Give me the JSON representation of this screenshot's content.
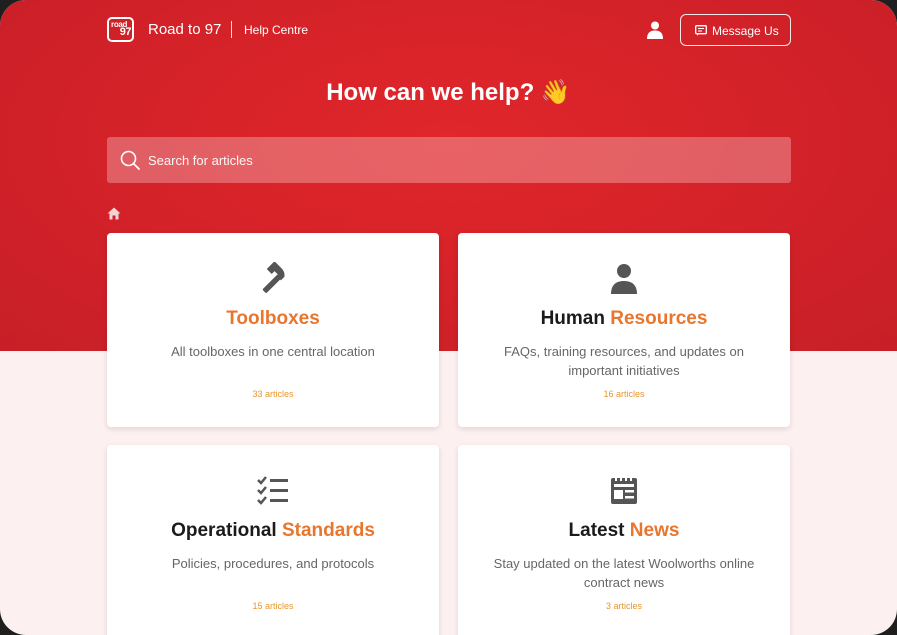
{
  "header": {
    "logo_line1": "road",
    "logo_line2": "97",
    "brand_name": "Road to 97",
    "brand_sub": "Help Centre",
    "message_button": "Message Us"
  },
  "hero": {
    "headline": "How can we help? 👋"
  },
  "search": {
    "placeholder": "Search for articles"
  },
  "cards": [
    {
      "title_main": "",
      "title_accent": "Toolboxes",
      "description": "All toolboxes in one central location",
      "count": "33 articles",
      "icon": "hammer-icon"
    },
    {
      "title_main": "Human ",
      "title_accent": "Resources",
      "description": "FAQs, training resources, and updates on important initiatives",
      "count": "16 articles",
      "icon": "person-icon"
    },
    {
      "title_main": "Operational ",
      "title_accent": "Standards",
      "description": "Policies, procedures, and protocols",
      "count": "15 articles",
      "icon": "checklist-icon"
    },
    {
      "title_main": "Latest ",
      "title_accent": "News",
      "description": "Stay updated on the latest Woolworths online contract news",
      "count": "3 articles",
      "icon": "newspaper-icon"
    }
  ],
  "colors": {
    "brand_red": "#d62229",
    "accent_orange": "#e8762c",
    "page_background": "#fdf0f0"
  }
}
